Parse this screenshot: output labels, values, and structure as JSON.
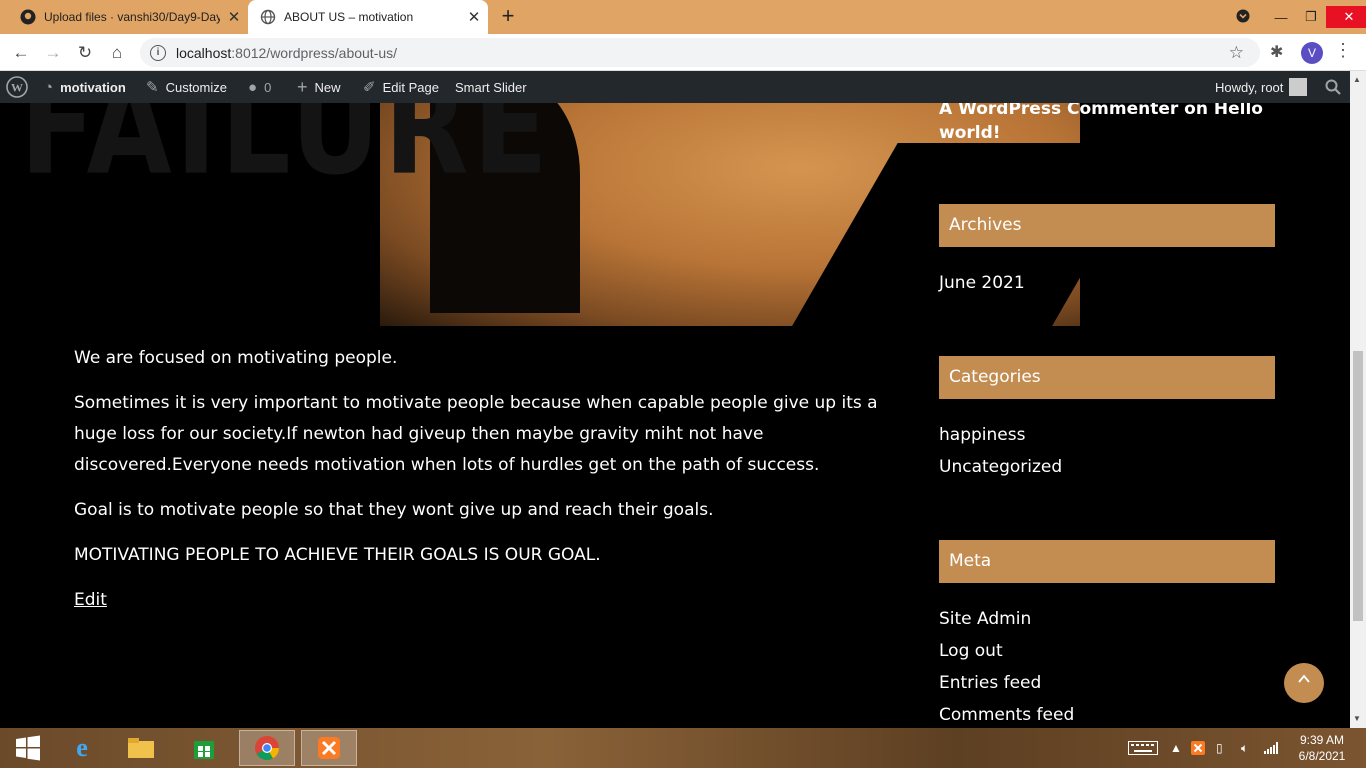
{
  "browser": {
    "tabs": [
      {
        "title": "Upload files · vanshi30/Day9-Day",
        "active": false
      },
      {
        "title": "ABOUT US – motivation",
        "active": true
      }
    ],
    "url_host": "localhost",
    "url_rest": ":8012/wordpress/about-us/",
    "profile_initial": "V"
  },
  "adminbar": {
    "site": "motivation",
    "customize": "Customize",
    "comments_count": "0",
    "new": "New",
    "edit_page": "Edit Page",
    "smart_slider": "Smart Slider",
    "howdy": "Howdy, root"
  },
  "content": {
    "p1": "We are focused on motivating people.",
    "p2": "Sometimes it is very important to motivate people because when capable people give up its a huge loss for our society.If newton had giveup then maybe gravity miht not have discovered.Everyone needs motivation when lots of hurdles get on the path of success.",
    "p3": "Goal is to motivate people so that they wont give up and reach their goals.",
    "p4": "MOTIVATING PEOPLE TO ACHIEVE THEIR GOALS IS OUR GOAL.",
    "edit": "Edit"
  },
  "sidebar": {
    "recent_comment_line1": "A WordPress Commenter on Hello",
    "recent_comment_line2": "world!",
    "archives_title": "Archives",
    "archives": [
      "June 2021"
    ],
    "categories_title": "Categories",
    "categories": [
      "happiness",
      "Uncategorized"
    ],
    "meta_title": "Meta",
    "meta": [
      "Site Admin",
      "Log out",
      "Entries feed",
      "Comments feed"
    ]
  },
  "taskbar": {
    "time": "9:39 AM",
    "date": "6/8/2021"
  },
  "colors": {
    "tab_strip": "#e0a464",
    "widget_header": "#c38d52",
    "admin_bar": "#23282d",
    "page_background": "#000000"
  }
}
